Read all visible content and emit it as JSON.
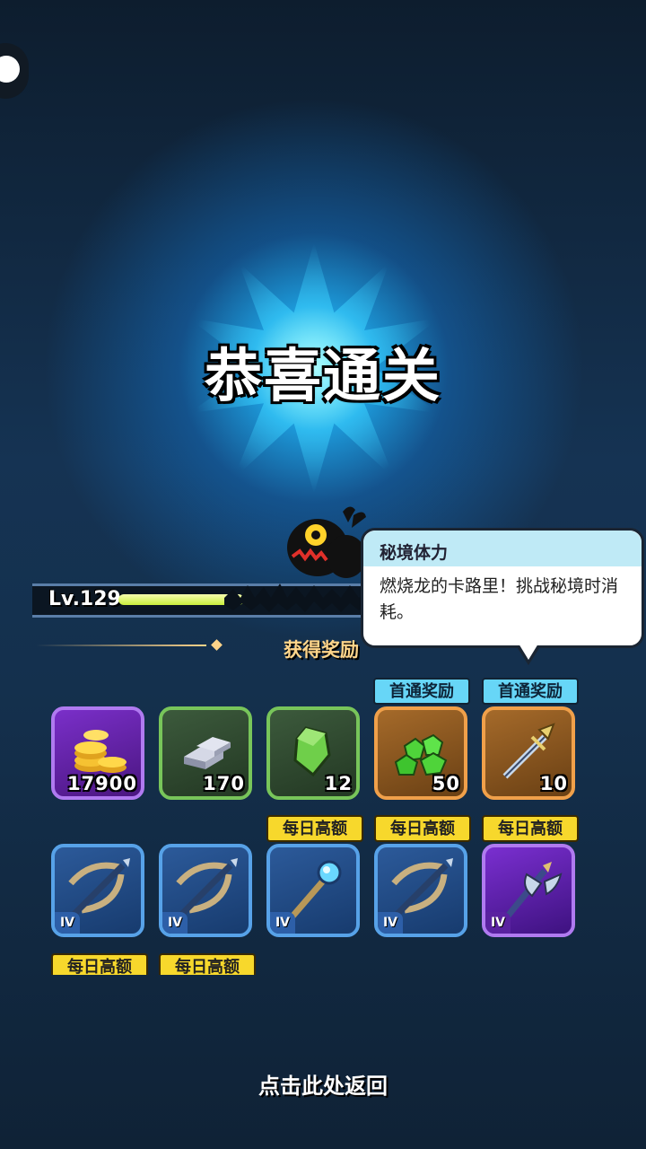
{
  "header": {
    "title": "恭喜通关"
  },
  "player": {
    "level": "Lv.129",
    "exp_fraction": 0.35
  },
  "tooltip": {
    "title": "秘境体力",
    "description": "燃烧龙的卡路里！挑战秘境时消耗。"
  },
  "rewards": {
    "section_title": "获得奖励",
    "row1": [
      {
        "icon": "gold-coins-icon",
        "quantity": "17900"
      },
      {
        "icon": "iron-ingot-icon",
        "quantity": "170"
      },
      {
        "icon": "green-crystal-icon",
        "quantity": "12"
      },
      {
        "icon": "emerald-gems-icon",
        "quantity": "50",
        "tag": "首通奖励"
      },
      {
        "icon": "trident-icon",
        "quantity": "10",
        "tag": "首通奖励"
      }
    ],
    "row2": [
      {
        "icon": "crossbow-icon",
        "rank": "IV"
      },
      {
        "icon": "crossbow-icon",
        "rank": "IV"
      },
      {
        "icon": "magic-staff-icon",
        "rank": "IV",
        "tag": "每日高额"
      },
      {
        "icon": "crossbow-icon",
        "rank": "IV",
        "tag": "每日高额"
      },
      {
        "icon": "battle-axe-icon",
        "rank": "IV",
        "tag": "每日高额"
      }
    ],
    "row3_tags": [
      "每日高额",
      "每日高额"
    ]
  },
  "footer": {
    "back_label": "点击此处返回"
  },
  "colors": {
    "accent_gold": "#ffd58a",
    "tag_blue": "#67d6f7",
    "tag_yellow": "#f7d82c"
  }
}
